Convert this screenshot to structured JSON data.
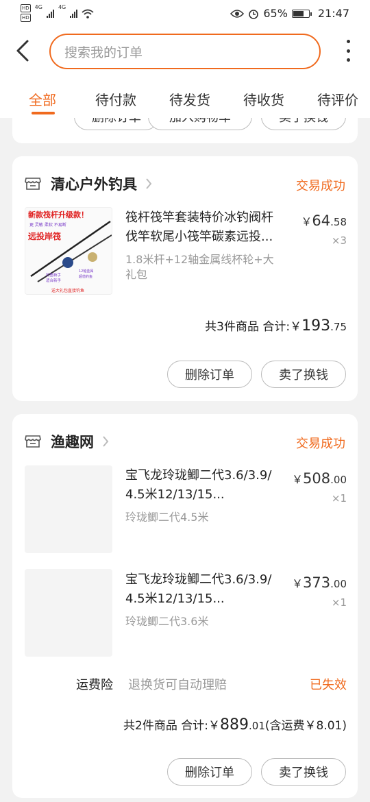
{
  "statusbar": {
    "hd1": "HD",
    "hd2": "HD",
    "net1": "4G",
    "net2": "4G",
    "battery": "65%",
    "time": "21:47",
    "battery_level": 0.65
  },
  "header": {
    "search_placeholder": "搜索我的订单",
    "icons": [
      "back-arrow-icon",
      "more-vertical-icon"
    ]
  },
  "tabs": [
    {
      "label": "全部",
      "active": true
    },
    {
      "label": "待付款"
    },
    {
      "label": "待发货"
    },
    {
      "label": "待收货"
    },
    {
      "label": "待评价"
    }
  ],
  "prev_card": {
    "buttons": [
      "删除订单",
      "加入购物车",
      "卖了换钱"
    ]
  },
  "orders": [
    {
      "shop": "清心户外钓具",
      "status": "交易成功",
      "items": [
        {
          "title": "筏杆筏竿套装特价冰钓阀杆伐竿软尾小筏竿碳素远投...",
          "sku": "1.8米杆+12轴金属线杯轮+大礼包",
          "price_currency": "￥",
          "price_int": "64",
          "price_dec": ".58",
          "qty": "×3",
          "thumb_texts": {
            "headline": "新款筏杆升级款！",
            "sub": "更 灵敏 柔软 不易断",
            "tag": "远投岸筏",
            "t1": "12轴金属",
            "t2": "超值钓鱼",
            "t3": "钓鱼新手",
            "t4": "适合新手",
            "bottom": "送大礼包直接钓鱼"
          }
        }
      ],
      "summary_count": "共3件商品",
      "summary_label": "合计:",
      "total_currency": "￥",
      "total_int": "193",
      "total_dec": ".75",
      "buttons": [
        "删除订单",
        "卖了换钱"
      ]
    },
    {
      "shop": "渔趣网",
      "status": "交易成功",
      "items": [
        {
          "title": "宝飞龙玲珑鲫二代3.6/3.9/4.5米12/13/15...",
          "sku": "玲珑鲫二代4.5米",
          "price_currency": "￥",
          "price_int": "508",
          "price_dec": ".00",
          "qty": "×1"
        },
        {
          "title": "宝飞龙玲珑鲫二代3.6/3.9/4.5米12/13/15...",
          "sku": "玲珑鲫二代3.6米",
          "price_currency": "￥",
          "price_int": "373",
          "price_dec": ".00",
          "qty": "×1"
        }
      ],
      "insurance": {
        "label": "运费险",
        "desc": "退换货可自动理赔",
        "status": "已失效"
      },
      "summary_count": "共2件商品",
      "summary_label": "合计:",
      "total_currency": "￥",
      "total_int": "889",
      "total_dec": ".01",
      "shipping_note": "(含运费￥8.01)",
      "buttons": [
        "删除订单",
        "卖了换钱"
      ]
    }
  ],
  "colors": {
    "accent": "#f06a1e",
    "background": "#f2f2f2"
  }
}
